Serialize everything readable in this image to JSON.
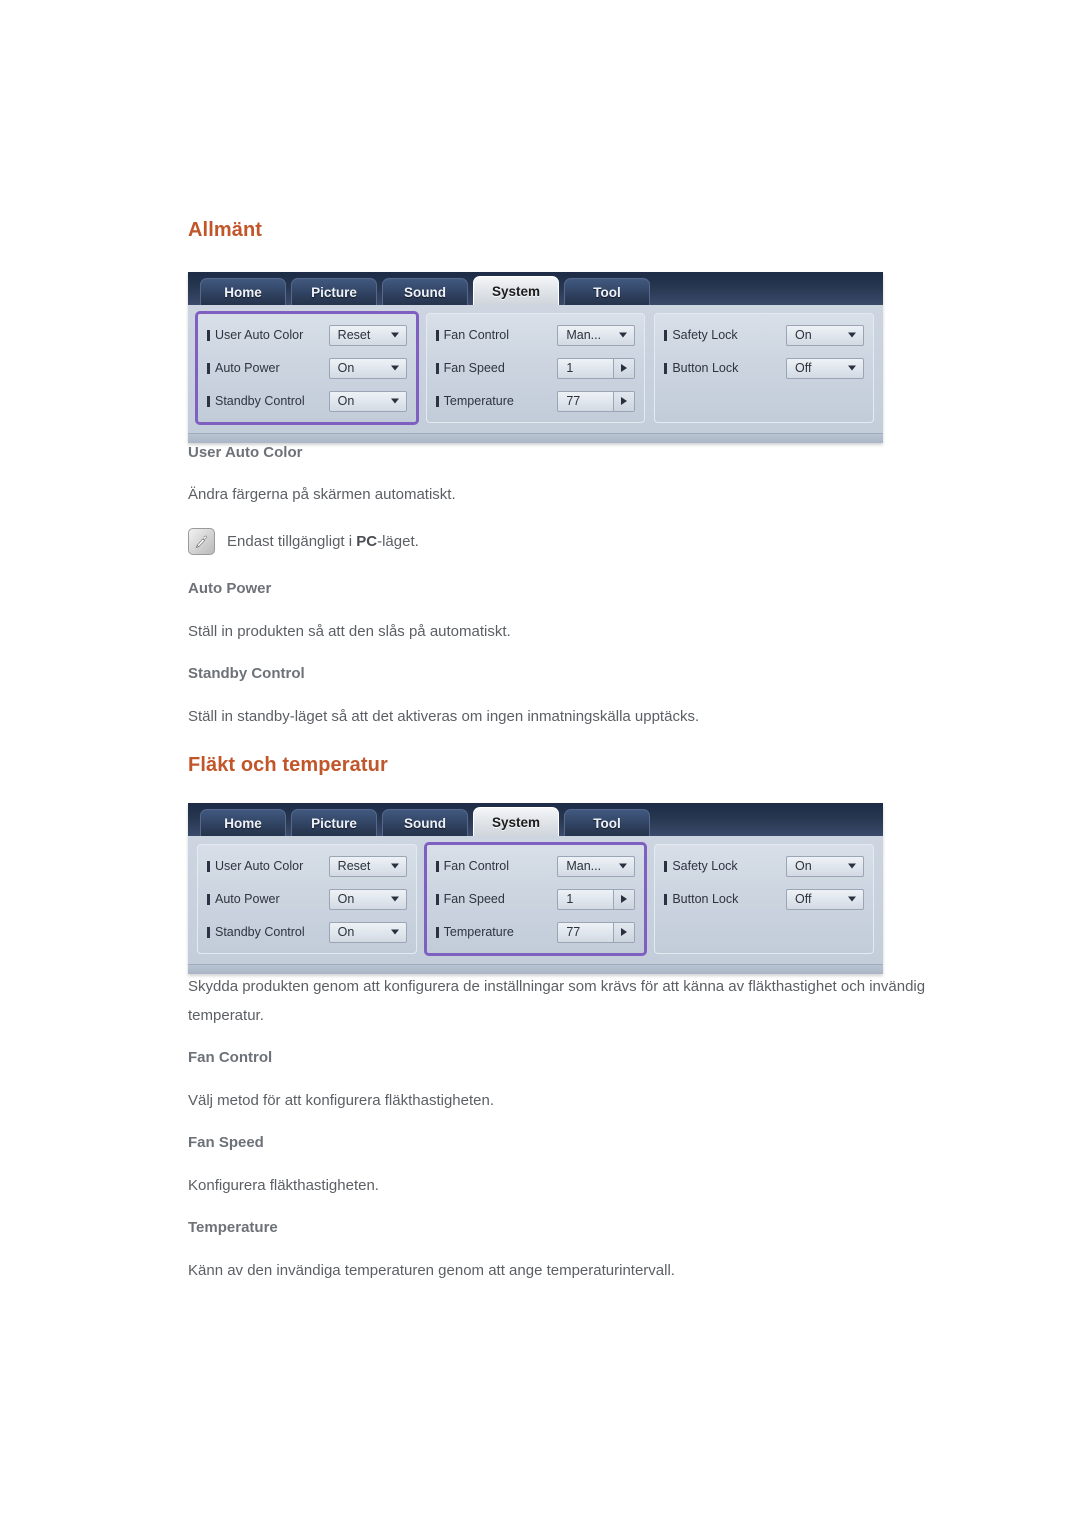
{
  "sections": [
    {
      "heading": "Allmänt",
      "topics": [
        {
          "title": "User Auto Color",
          "body": "Ändra färgerna på skärmen automatiskt."
        },
        {
          "title": "Auto Power",
          "body": "Ställ in produkten så att den slås på automatiskt."
        },
        {
          "title": "Standby Control",
          "body": "Ställ in standby-läget så att det aktiveras om ingen inmatningskälla upptäcks."
        }
      ],
      "note": {
        "icon": "note-pencil-icon",
        "text_before": "Endast tillgängligt i ",
        "emphasis": "PC",
        "text_after": "-läget."
      }
    },
    {
      "heading": "Fläkt och temperatur",
      "intro": "Skydda produkten genom att konfigurera de inställningar som krävs för att känna av fläkthastighet och invändig temperatur.",
      "topics": [
        {
          "title": "Fan Control",
          "body": "Välj metod för att konfigurera fläkthastigheten."
        },
        {
          "title": "Fan Speed",
          "body": "Konfigurera fläkthastigheten."
        },
        {
          "title": "Temperature",
          "body": "Känn av den invändiga temperaturen genom att ange temperaturintervall."
        }
      ]
    }
  ],
  "osd": {
    "tabs": [
      {
        "label": "Home",
        "active": false
      },
      {
        "label": "Picture",
        "active": false
      },
      {
        "label": "Sound",
        "active": false
      },
      {
        "label": "System",
        "active": true
      },
      {
        "label": "Tool",
        "active": false
      }
    ],
    "columns": [
      {
        "rows": [
          {
            "label": "User Auto Color",
            "value": "Reset",
            "control": "dropdown"
          },
          {
            "label": "Auto Power",
            "value": "On",
            "control": "dropdown"
          },
          {
            "label": "Standby Control",
            "value": "On",
            "control": "dropdown"
          }
        ]
      },
      {
        "rows": [
          {
            "label": "Fan Control",
            "value": "Man...",
            "control": "dropdown"
          },
          {
            "label": "Fan Speed",
            "value": "1",
            "control": "stepper"
          },
          {
            "label": "Temperature",
            "value": "77",
            "control": "stepper"
          }
        ]
      },
      {
        "rows": [
          {
            "label": "Safety Lock",
            "value": "On",
            "control": "dropdown"
          },
          {
            "label": "Button Lock",
            "value": "Off",
            "control": "dropdown"
          }
        ]
      }
    ],
    "highlight_first": 0,
    "highlight_second": 1
  },
  "colors": {
    "heading": "#c1562a",
    "body_text": "#5b5f64",
    "sub_heading": "#6d7278",
    "osd_highlight": "#7f5fc0",
    "osd_tabbar": "#26364f"
  }
}
